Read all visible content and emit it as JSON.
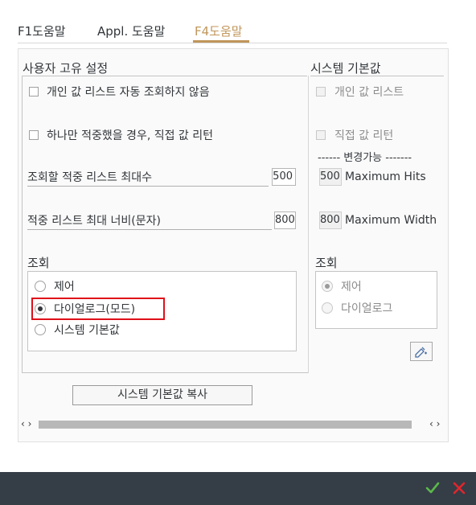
{
  "tabs": [
    {
      "label": "F1도움말",
      "active": false
    },
    {
      "label": "Appl. 도움말",
      "active": false
    },
    {
      "label": "F4도움말",
      "active": true
    }
  ],
  "user_settings": {
    "title": "사용자 고유 설정",
    "checkbox_no_auto_display": "개인 값 리스트 자동 조회하지 않음",
    "checkbox_direct_return": "하나만 적중했을 경우, 직접 값 리턴",
    "max_hits_label": "조회할 적중 리스트 최대수",
    "max_hits_value": "500",
    "max_width_label": "적중 리스트 최대 너비(문자)",
    "max_width_value": "800",
    "display_title": "조회",
    "radio_control": "제어",
    "radio_dialog": "다이얼로그(모드)",
    "radio_system_default": "시스템 기본값",
    "selected_radio": "dialog"
  },
  "system_defaults": {
    "title": "시스템 기본값",
    "checkbox_personal_list": "개인 값 리스트",
    "checkbox_direct_return": "직접 값 리턴",
    "changeable_label": "------ 변경가능 -------",
    "max_hits_value": "500",
    "max_hits_label": "Maximum Hits",
    "max_width_value": "800",
    "max_width_label": "Maximum Width",
    "display_title": "조회",
    "radio_control": "제어",
    "radio_dialog": "다이얼로그",
    "selected_radio": "control"
  },
  "copy_button_label": "시스템 기본값 복사",
  "scroll": {
    "left_arrows": "‹ ›",
    "right_arrows": "‹ ›"
  },
  "colors": {
    "accent": "#c0965a",
    "highlight": "#e0101a",
    "footer": "#353d47",
    "ok": "#5bb84a",
    "cancel": "#e0262c"
  },
  "icons": {
    "edit": "edit-settings-icon",
    "ok": "check-icon",
    "cancel": "close-icon"
  }
}
